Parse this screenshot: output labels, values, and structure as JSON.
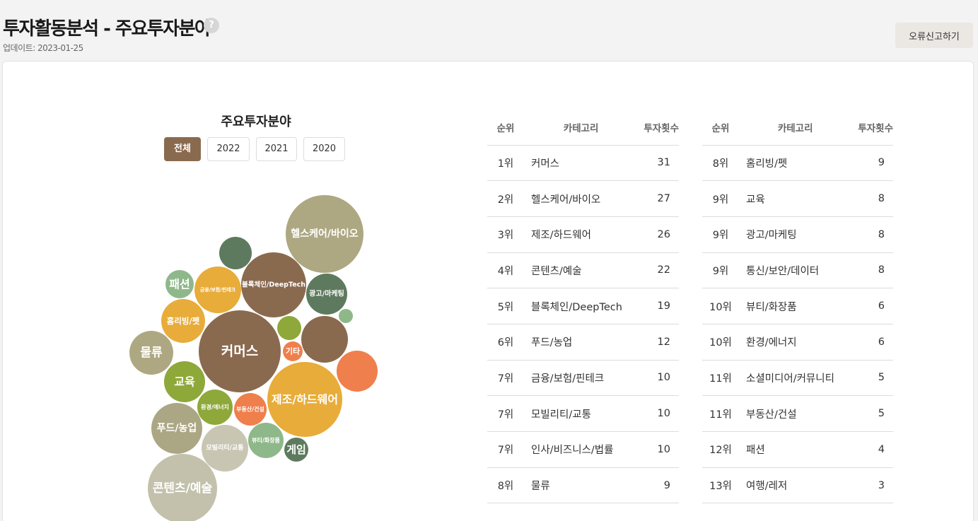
{
  "header": {
    "title": "투자활동분석 - 주요투자분야",
    "help_icon": "?",
    "updated": "업데이트: 2023-01-25",
    "report_button": "오류신고하기"
  },
  "chart_section": {
    "title": "주요투자분야",
    "tabs": [
      "전체",
      "2022",
      "2021",
      "2020"
    ],
    "active_tab": "전체"
  },
  "colors": {
    "brown": "#8a6a4f",
    "olive": "#a9a385",
    "khaki": "#b9b6a0",
    "beige": "#c8c6b3",
    "dark_green": "#5e7a5e",
    "sage": "#8fb88a",
    "lime": "#8ea83a",
    "mustard": "#e8ac3a",
    "orange": "#ef7f4c"
  },
  "chart_data": {
    "type": "bubble",
    "title": "주요투자분야",
    "bubbles": [
      {
        "label": "커머스",
        "value": 31,
        "color": "#8a6a4f"
      },
      {
        "label": "헬스케어/바이오",
        "value": 27,
        "color": "#ada882"
      },
      {
        "label": "제조/하드웨어",
        "value": 26,
        "color": "#e8ac3a"
      },
      {
        "label": "콘텐츠/예술",
        "value": 22,
        "color": "#c3c1ac"
      },
      {
        "label": "블록체인/DeepTech",
        "value": 19,
        "color": "#8a6a4f"
      },
      {
        "label": "푸드/농업",
        "value": 12,
        "color": "#aba684"
      },
      {
        "label": "금융/보험/핀테크",
        "value": 10,
        "color": "#e8ac3a"
      },
      {
        "label": "모빌리티/교통",
        "value": 10,
        "color": "#c8c6b3"
      },
      {
        "label": "",
        "value": 10,
        "color": "#8a6a4f"
      },
      {
        "label": "물류",
        "value": 9,
        "color": "#ada882"
      },
      {
        "label": "홈리빙/펫",
        "value": 9,
        "color": "#e8ac3a"
      },
      {
        "label": "교육",
        "value": 8,
        "color": "#8ea83a"
      },
      {
        "label": "광고/마케팅",
        "value": 8,
        "color": "#5e7a5e"
      },
      {
        "label": "",
        "value": 8,
        "color": "#ef7f4c"
      },
      {
        "label": "뷰티/화장품",
        "value": 6,
        "color": "#8fb88a"
      },
      {
        "label": "환경/에너지",
        "value": 6,
        "color": "#8ea83a"
      },
      {
        "label": "",
        "value": 5,
        "color": "#5e7a5e"
      },
      {
        "label": "부동산/건설",
        "value": 5,
        "color": "#ef7f4c"
      },
      {
        "label": "패션",
        "value": 4,
        "color": "#8fb88a"
      },
      {
        "label": "게임",
        "value": 3,
        "color": "#5e7a5e"
      },
      {
        "label": "",
        "value": 3,
        "color": "#8ea83a"
      },
      {
        "label": "기타",
        "value": 2,
        "color": "#ef7f4c"
      },
      {
        "label": "",
        "value": 1,
        "color": "#8fb88a"
      }
    ]
  },
  "table": {
    "headers": [
      "순위",
      "카테고리",
      "투자횟수"
    ],
    "left_rows": [
      {
        "rank": "1위",
        "category": "커머스",
        "count": "31"
      },
      {
        "rank": "2위",
        "category": "헬스케어/바이오",
        "count": "27"
      },
      {
        "rank": "3위",
        "category": "제조/하드웨어",
        "count": "26"
      },
      {
        "rank": "4위",
        "category": "콘텐츠/예술",
        "count": "22"
      },
      {
        "rank": "5위",
        "category": "블록체인/DeepTech",
        "count": "19"
      },
      {
        "rank": "6위",
        "category": "푸드/농업",
        "count": "12"
      },
      {
        "rank": "7위",
        "category": "금융/보험/핀테크",
        "count": "10"
      },
      {
        "rank": "7위",
        "category": "모빌리티/교통",
        "count": "10"
      },
      {
        "rank": "7위",
        "category": "인사/비즈니스/법률",
        "count": "10"
      },
      {
        "rank": "8위",
        "category": "물류",
        "count": "9"
      }
    ],
    "right_rows": [
      {
        "rank": "8위",
        "category": "홈리빙/펫",
        "count": "9"
      },
      {
        "rank": "9위",
        "category": "교육",
        "count": "8"
      },
      {
        "rank": "9위",
        "category": "광고/마케팅",
        "count": "8"
      },
      {
        "rank": "9위",
        "category": "통신/보안/데이터",
        "count": "8"
      },
      {
        "rank": "10위",
        "category": "뷰티/화장품",
        "count": "6"
      },
      {
        "rank": "10위",
        "category": "환경/에너지",
        "count": "6"
      },
      {
        "rank": "11위",
        "category": "소셜미디어/커뮤니티",
        "count": "5"
      },
      {
        "rank": "11위",
        "category": "부동산/건설",
        "count": "5"
      },
      {
        "rank": "12위",
        "category": "패션",
        "count": "4"
      },
      {
        "rank": "13위",
        "category": "여행/레저",
        "count": "3"
      }
    ]
  }
}
